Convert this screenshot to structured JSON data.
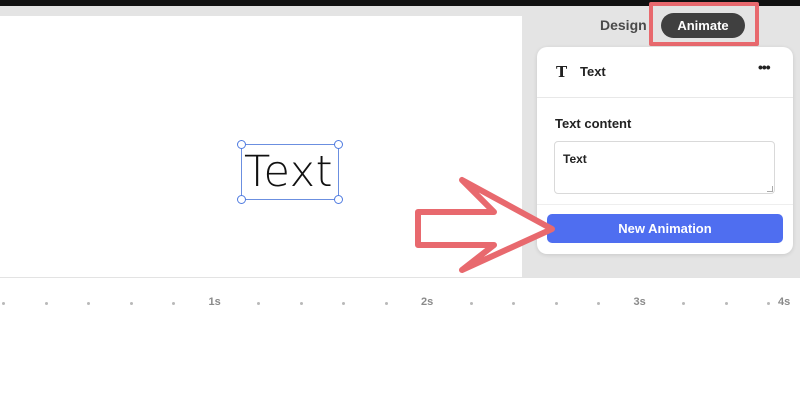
{
  "toolbar": {
    "tabs": [
      {
        "label": "Design",
        "active": false
      },
      {
        "label": "Animate",
        "active": true
      }
    ]
  },
  "canvas": {
    "selected_element_text": "Text"
  },
  "panel": {
    "icon": "text-type-icon",
    "icon_glyph": "T",
    "title": "Text",
    "more_glyph": "•••",
    "field_label": "Text content",
    "field_value": "Text",
    "primary_button_label": "New Animation"
  },
  "timeline": {
    "labels": [
      "1s",
      "2s",
      "3s",
      "4s"
    ]
  },
  "colors": {
    "accent_blue": "#4f6ef0",
    "active_tab_bg": "#404040",
    "annotation_red": "#e8696e",
    "selection_blue": "#4f7be0"
  }
}
